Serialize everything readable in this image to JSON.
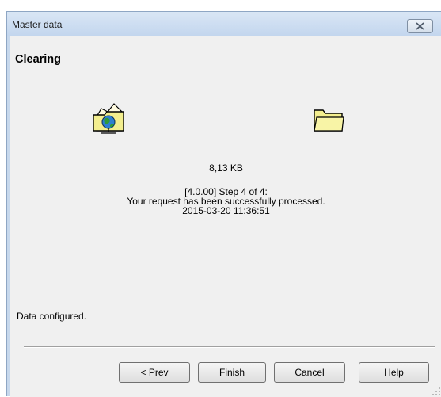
{
  "window": {
    "title": "Master data",
    "close_icon": "close-x-icon"
  },
  "content": {
    "heading": "Clearing",
    "source_icon": "globe-folder-icon",
    "target_icon": "folder-icon",
    "size": "8,13 KB",
    "status_lines": [
      "[4.0.00] Step 4 of 4:",
      "Your request has been successfully processed.",
      "2015-03-20 11:36:51"
    ],
    "footer_status": "Data configured."
  },
  "buttons": {
    "prev": "< Prev",
    "finish": "Finish",
    "cancel": "Cancel",
    "help": "Help"
  },
  "colors": {
    "frame": "#c7d8ec",
    "client": "#f0f0f0",
    "folder": "#f3ee8e"
  }
}
